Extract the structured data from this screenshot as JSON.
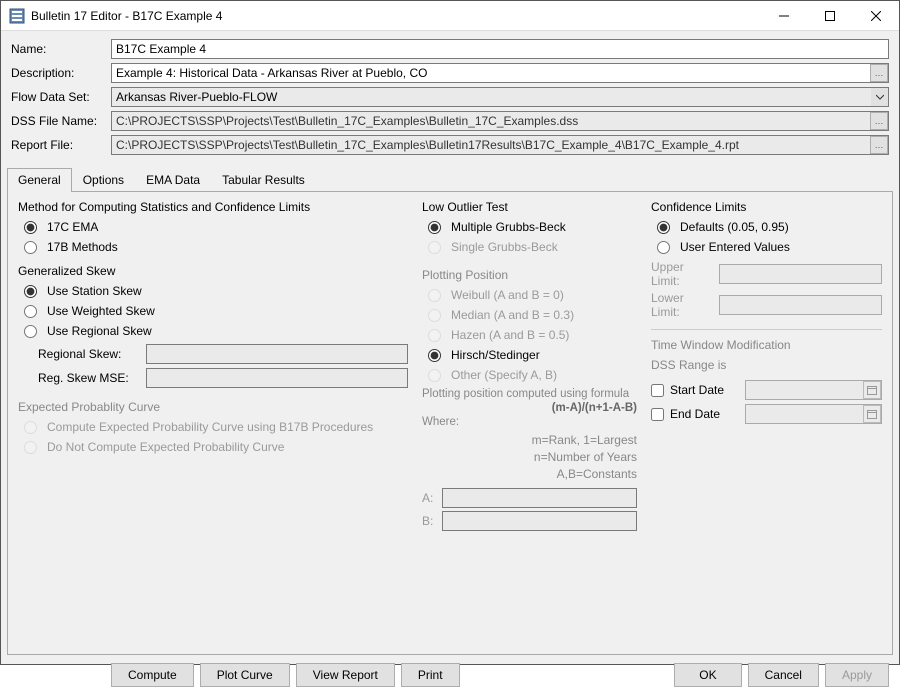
{
  "window": {
    "title": "Bulletin 17 Editor - B17C Example 4"
  },
  "fields": {
    "name_label": "Name:",
    "name_value": "B17C Example 4",
    "description_label": "Description:",
    "description_value": "Example 4: Historical Data - Arkansas River at Pueblo, CO",
    "flowdataset_label": "Flow Data Set:",
    "flowdataset_value": "Arkansas River-Pueblo-FLOW",
    "dssfile_label": "DSS File Name:",
    "dssfile_value": "C:\\PROJECTS\\SSP\\Projects\\Test\\Bulletin_17C_Examples\\Bulletin_17C_Examples.dss",
    "reportfile_label": "Report File:",
    "reportfile_value": "C:\\PROJECTS\\SSP\\Projects\\Test\\Bulletin_17C_Examples\\Bulletin17Results\\B17C_Example_4\\B17C_Example_4.rpt"
  },
  "tabs": {
    "general": "General",
    "options": "Options",
    "ema": "EMA Data",
    "tabular": "Tabular Results"
  },
  "general": {
    "method_title": "Method for Computing Statistics and Confidence Limits",
    "method_ema": "17C EMA",
    "method_17b": "17B Methods",
    "gskew_title": "Generalized Skew",
    "gskew_station": "Use Station Skew",
    "gskew_weighted": "Use Weighted Skew",
    "gskew_regional": "Use Regional Skew",
    "regional_skew_label": "Regional Skew:",
    "reg_skew_mse_label": "Reg. Skew MSE:",
    "expected_title": "Expected Probablity Curve",
    "expected_compute": "Compute Expected Probability Curve using B17B Procedures",
    "expected_donot": "Do Not Compute Expected Probability Curve",
    "low_outlier_title": "Low Outlier Test",
    "lo_multiple": "Multiple Grubbs-Beck",
    "lo_single": "Single Grubbs-Beck",
    "plotting_title": "Plotting Position",
    "pp_weibull": "Weibull (A and B = 0)",
    "pp_median": "Median (A and B = 0.3)",
    "pp_hazen": "Hazen (A and B = 0.5)",
    "pp_hirsch": "Hirsch/Stedinger",
    "pp_other": "Other (Specify A, B)",
    "pp_formula_text": "Plotting position computed using formula",
    "pp_formula": "(m-A)/(n+1-A-B)",
    "pp_where": "Where:",
    "pp_legend1": "m=Rank, 1=Largest",
    "pp_legend2": "n=Number of Years",
    "pp_legend3": "A,B=Constants",
    "pp_a": "A:",
    "pp_b": "B:",
    "conf_title": "Confidence Limits",
    "conf_defaults": "Defaults (0.05, 0.95)",
    "conf_user": "User Entered Values",
    "conf_upper": "Upper Limit:",
    "conf_lower": "Lower Limit:",
    "time_title": "Time Window Modification",
    "dss_range": "DSS Range is",
    "start_date": "Start Date",
    "end_date": "End Date"
  },
  "buttons": {
    "compute": "Compute",
    "plot": "Plot Curve",
    "view": "View Report",
    "print": "Print",
    "ok": "OK",
    "cancel": "Cancel",
    "apply": "Apply"
  }
}
